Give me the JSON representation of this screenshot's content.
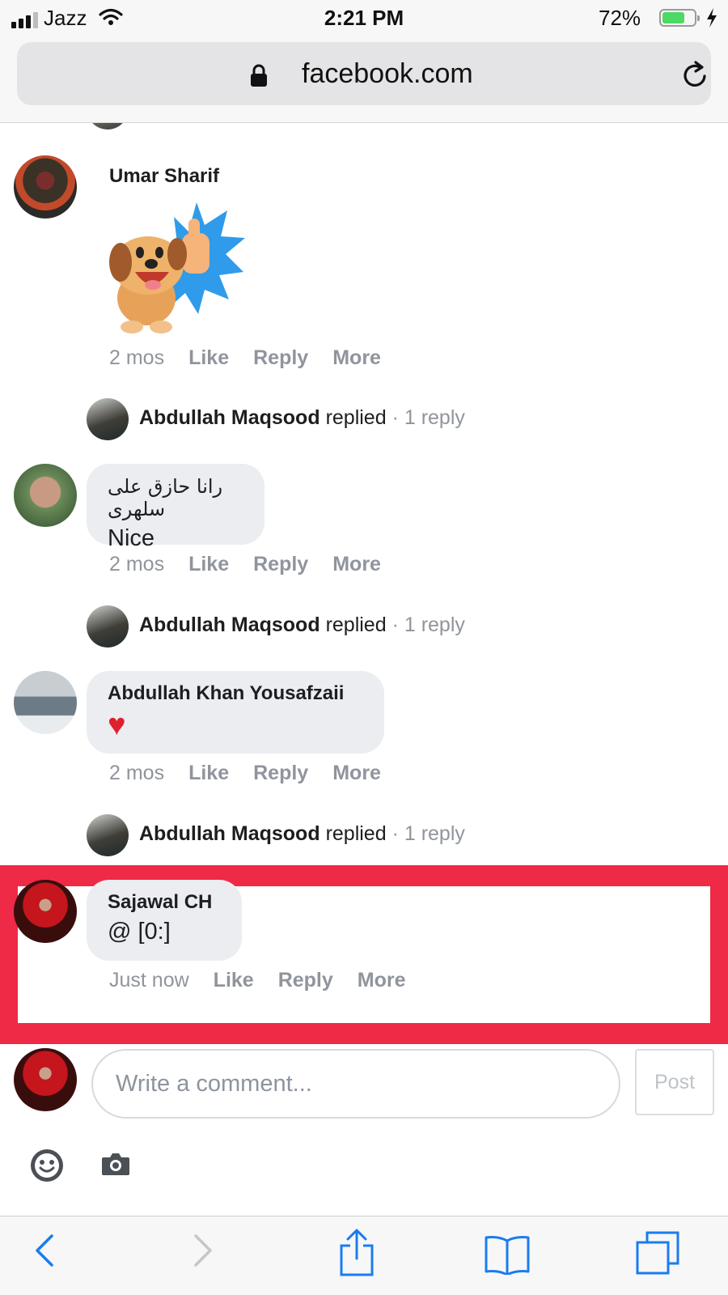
{
  "status_bar": {
    "carrier": "Jazz",
    "time": "2:21 PM",
    "battery_percent": "72%",
    "battery_level": 0.72
  },
  "browser": {
    "url": "facebook.com",
    "icons": [
      "lock-icon",
      "reload-icon",
      "back-icon",
      "forward-icon",
      "share-icon",
      "bookmarks-icon",
      "tabs-icon"
    ]
  },
  "comments": [
    {
      "author": "Umar Sharif",
      "content_type": "sticker",
      "sticker": "dog-thumbs-up-sticker",
      "time": "2 mos",
      "like": "Like",
      "reply": "Reply",
      "more": "More",
      "reply_summary": {
        "name": "Abdullah Maqsood",
        "verb": "replied",
        "meta": "· 1 reply"
      }
    },
    {
      "author": "رانا حازق علی سلھری",
      "text": "Nice",
      "time": "2 mos",
      "like": "Like",
      "reply": "Reply",
      "more": "More",
      "reply_summary": {
        "name": "Abdullah Maqsood",
        "verb": "replied",
        "meta": "· 1 reply"
      }
    },
    {
      "author": "Abdullah Khan Yousafzaii",
      "text": "♥",
      "time": "2 mos",
      "like": "Like",
      "reply": "Reply",
      "more": "More",
      "reply_summary": {
        "name": "Abdullah Maqsood",
        "verb": "replied",
        "meta": "· 1 reply"
      }
    },
    {
      "author": "Sajawal CH",
      "text": "@ [0:]",
      "time": "Just now",
      "like": "Like",
      "reply": "Reply",
      "more": "More",
      "highlighted": true
    }
  ],
  "composer": {
    "placeholder": "Write a comment...",
    "post_label": "Post"
  },
  "colors": {
    "highlight": "#ee2a46",
    "bubble": "#ebedf0",
    "meta_text": "#90949c",
    "ios_blue": "#1a7cf0"
  }
}
